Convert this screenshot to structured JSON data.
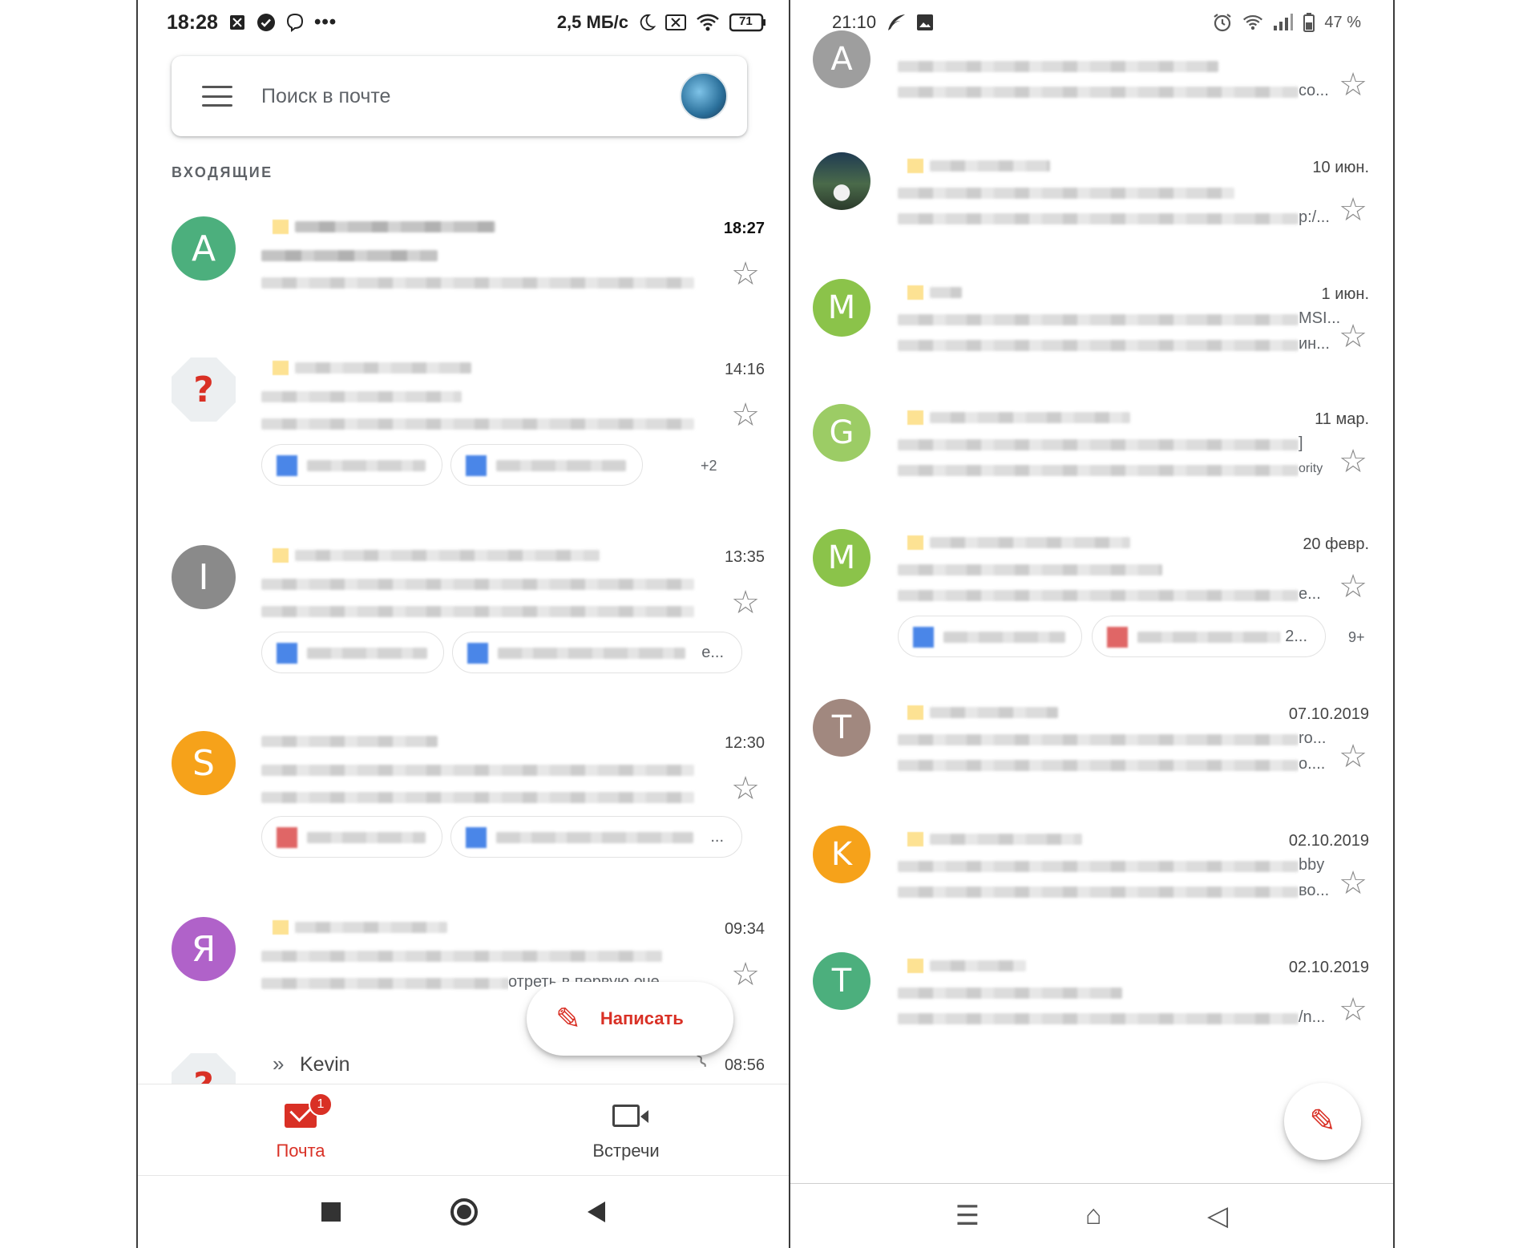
{
  "left_phone": {
    "status": {
      "time": "18:28",
      "speed": "2,5 МБ/с",
      "battery": "71",
      "icons": [
        "sim-icon",
        "check-circle-icon",
        "viber-icon",
        "more-dots-icon",
        "moon-icon",
        "no-sim-icon",
        "wifi-icon",
        "battery-icon"
      ]
    },
    "search": {
      "placeholder": "Поиск в почте"
    },
    "section_label": "ВХОДЯЩИЕ",
    "emails": [
      {
        "avatar": "A",
        "color": "#4caf7d",
        "time": "18:27",
        "unread": true,
        "starred": false
      },
      {
        "avatar": "?",
        "color": "#eceff1",
        "time": "14:16",
        "unread": false,
        "starred": false,
        "more_attachments": "+2"
      },
      {
        "avatar": "I",
        "color": "#8a8a8a",
        "time": "13:35",
        "unread": false,
        "starred": false,
        "chip_tail": "e..."
      },
      {
        "avatar": "S",
        "color": "#f6a21a",
        "time": "12:30",
        "unread": false,
        "starred": false,
        "chip_tail": "..."
      },
      {
        "avatar": "Я",
        "color": "#b062c9",
        "time": "09:34",
        "unread": false,
        "starred": false,
        "snippet_tail": "отреть в первую оче"
      },
      {
        "avatar": "?",
        "color": "#eceff1",
        "time": "08:56",
        "sender": "Kevin",
        "forward": "»"
      }
    ],
    "compose_label": "Написать",
    "bottom_nav": [
      {
        "label": "Почта",
        "badge": "1",
        "active": true
      },
      {
        "label": "Встречи",
        "active": false
      }
    ]
  },
  "right_phone": {
    "status": {
      "time": "21:10",
      "battery": "47 %",
      "icons": [
        "feather-icon",
        "image-icon",
        "alarm-icon",
        "wifi-icon",
        "signal-icon",
        "battery-icon"
      ]
    },
    "emails": [
      {
        "avatar": "A",
        "color": "#9e9e9e",
        "time": "",
        "tails": [
          "co..."
        ]
      },
      {
        "avatar": "",
        "color": "photo",
        "time": "10 июн.",
        "tails": [
          "p:/..."
        ]
      },
      {
        "avatar": "M",
        "color": "#8bc34a",
        "time": "1 июн.",
        "tails": [
          "MSI...",
          "ин..."
        ]
      },
      {
        "avatar": "G",
        "color": "#9ccc65",
        "time": "11 мар.",
        "tails": [
          "]",
          "ority"
        ]
      },
      {
        "avatar": "M",
        "color": "#8bc34a",
        "time": "20 февр.",
        "tails": [
          "e..."
        ],
        "chip_tail": "2...",
        "more_attachments": "9+"
      },
      {
        "avatar": "T",
        "color": "#a1887f",
        "time": "07.10.2019",
        "tails": [
          "ro...",
          "o...."
        ]
      },
      {
        "avatar": "K",
        "color": "#f6a21a",
        "time": "02.10.2019",
        "tails": [
          "bby",
          "во..."
        ]
      },
      {
        "avatar": "T",
        "color": "#4caf7d",
        "time": "02.10.2019",
        "tails": [
          "/n..."
        ]
      }
    ]
  }
}
